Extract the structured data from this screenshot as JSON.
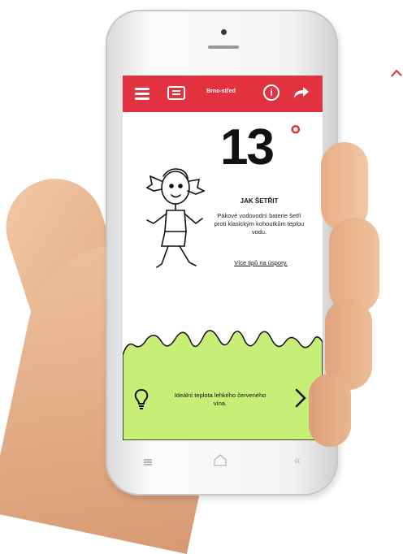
{
  "colors": {
    "accent": "#e2323f",
    "grass": "#c7ee76"
  },
  "header": {
    "location": "Brno-střed",
    "icons": [
      "menu-icon",
      "card-icon",
      "info-icon",
      "share-icon"
    ]
  },
  "weather": {
    "temperature": "13",
    "unit": "°"
  },
  "tip": {
    "title": "JAK ŠETŘIT",
    "text": "Pákové vodovodní baterie šetří proti klasickým kohoutkům teplou vodu.",
    "link": "Více tipů na úspory."
  },
  "hint": {
    "text": "Ideální teplota lehkého červeného vína.",
    "icon": "lightbulb-icon"
  },
  "nav": {
    "icons": [
      "menu-icon",
      "home-icon",
      "back-icon"
    ],
    "back_glyph": "«"
  }
}
